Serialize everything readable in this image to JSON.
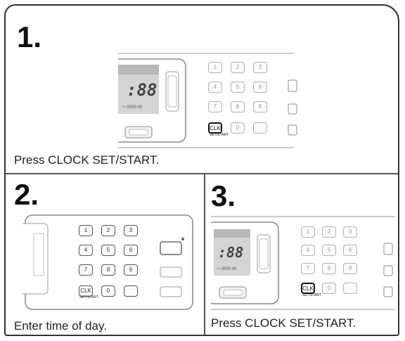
{
  "steps": [
    {
      "number": "1.",
      "caption": "Press CLOCK SET/START."
    },
    {
      "number": "2.",
      "caption": "Enter time of day."
    },
    {
      "number": "3.",
      "caption": "Press CLOCK SET/START."
    }
  ],
  "display": {
    "digits": "88"
  },
  "keypad": [
    "1",
    "2",
    "3",
    "4",
    "5",
    "6",
    "7",
    "8",
    "9",
    "",
    "0",
    ""
  ],
  "clock_key": {
    "line1": "CLK",
    "line2": "SET/START"
  }
}
